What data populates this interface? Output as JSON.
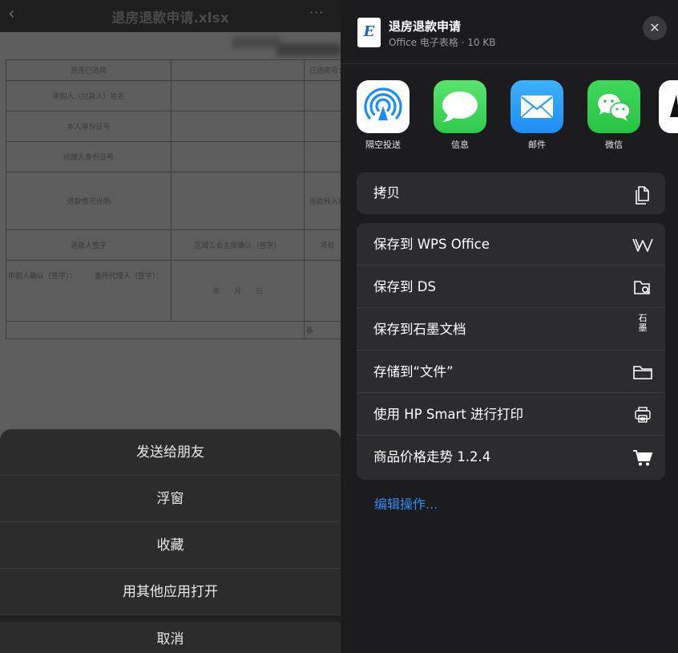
{
  "viewer": {
    "title": "退房退款申请.xlsx",
    "back_icon": "‹",
    "more_icon": "···"
  },
  "form": {
    "rows": [
      [
        "是否已选房",
        "",
        "已选房号："
      ],
      [
        "申购人（付款人）姓名",
        "",
        ""
      ],
      [
        "本人身份证号",
        "",
        ""
      ],
      [
        "代理人身份证号",
        "",
        ""
      ],
      [
        "退款情况说明",
        "",
        "退款转入银"
      ],
      [
        "退款人签字",
        "区域工会主席确认（签字）",
        "项目"
      ],
      [
        "申购人确认（签字）：　　　委托代理人（签字）：",
        "年　　月　　日",
        ""
      ],
      [
        "",
        "",
        "备"
      ]
    ]
  },
  "action_sheet": {
    "items": [
      "发送给朋友",
      "浮窗",
      "收藏",
      "用其他应用打开"
    ],
    "cancel": "取消"
  },
  "share": {
    "file_title": "退房退款申请",
    "file_meta": "Office 电子表格 · 10 KB",
    "file_icon_letter": "E",
    "close_icon": "✕",
    "apps": [
      {
        "label": "隔空投送",
        "icon": "airdrop-icon"
      },
      {
        "label": "信息",
        "icon": "messages-icon"
      },
      {
        "label": "邮件",
        "icon": "mail-icon"
      },
      {
        "label": "微信",
        "icon": "wechat-icon"
      }
    ],
    "copy_group": [
      {
        "label": "拷贝",
        "icon": "copy-icon"
      }
    ],
    "actions": [
      {
        "label": "保存到 WPS Office",
        "icon": "wps-icon"
      },
      {
        "label": "保存到 DS",
        "icon": "ds-folder-icon"
      },
      {
        "label": "保存到石墨文档",
        "icon": "shimo-icon",
        "icon_text": "石墨"
      },
      {
        "label": "存储到“文件”",
        "icon": "folder-icon"
      },
      {
        "label": "使用 HP Smart 进行打印",
        "icon": "printer-icon"
      },
      {
        "label": "商品价格走势 1.2.4",
        "icon": "cart-icon"
      }
    ],
    "edit_actions": "编辑操作..."
  },
  "colors": {
    "accent_blue": "#2f8cf6",
    "messages_green": "#2fca4e",
    "wechat_green": "#28c445",
    "mail_blue": "#1f8cf4"
  }
}
